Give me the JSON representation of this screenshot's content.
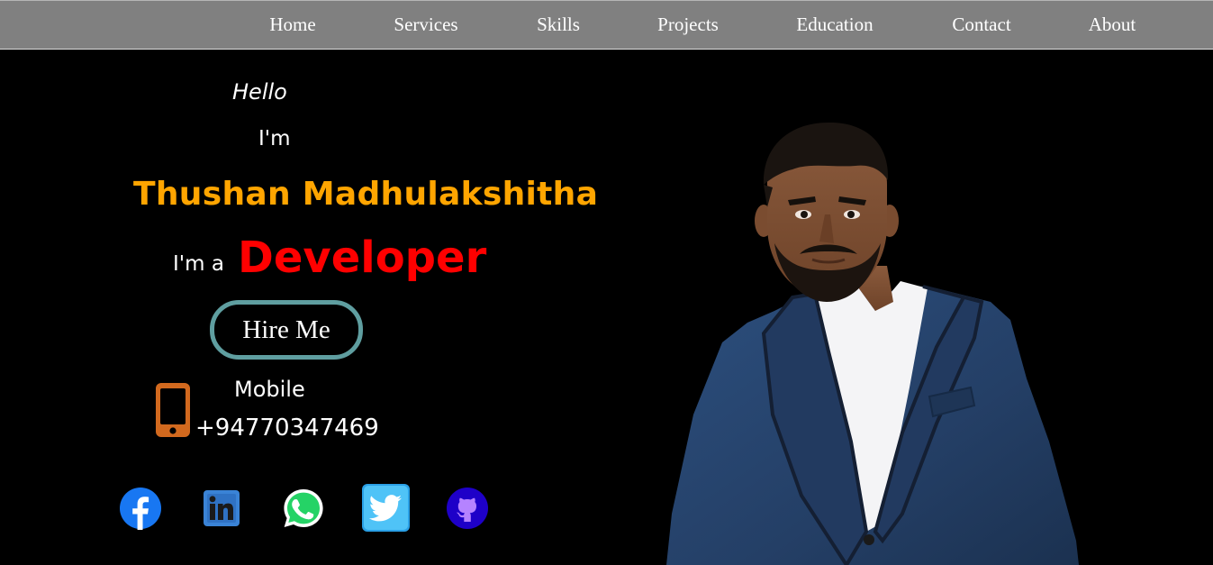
{
  "nav": {
    "items": [
      {
        "label": "Home"
      },
      {
        "label": "Services"
      },
      {
        "label": "Skills"
      },
      {
        "label": "Projects"
      },
      {
        "label": "Education"
      },
      {
        "label": "Contact"
      },
      {
        "label": "About"
      }
    ]
  },
  "hero": {
    "greeting": "Hello",
    "intro": "I'm",
    "name": "Thushan Madhulakshitha",
    "role_prefix": "I'm a",
    "role": "Developer",
    "cta_label": "Hire Me"
  },
  "contact": {
    "mobile_label": "Mobile",
    "mobile_number": "+94770347469"
  },
  "social": [
    {
      "icon": "facebook-icon"
    },
    {
      "icon": "linkedin-icon"
    },
    {
      "icon": "whatsapp-icon"
    },
    {
      "icon": "twitter-icon"
    },
    {
      "icon": "github-icon"
    }
  ],
  "colors": {
    "background": "#000000",
    "nav_background": "#808080",
    "name": "#ffa500",
    "role": "#ff0000",
    "button_border": "#5f9ea0",
    "phone_icon": "#d2691e"
  }
}
